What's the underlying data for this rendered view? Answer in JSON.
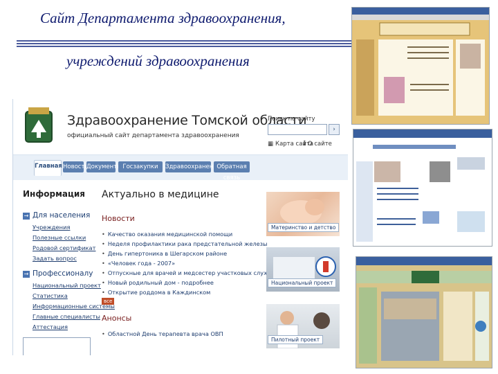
{
  "slide": {
    "title_line1": "Сайт Департамента здравоохранения,",
    "title_line2": "учреждений здравоохранения"
  },
  "site": {
    "name": "Здравоохранение Томской области",
    "subtitle": "официальный сайт департамента здравоохранения",
    "search_label": "Поиск по сайту",
    "util_sitemap": "Карта сайта",
    "util_about": "О сайте",
    "tabs": [
      "Главная",
      "Новости",
      "Документы",
      "Госзакупки",
      "Здравоохранение",
      "Обратная связь"
    ],
    "left_heading": "Информация",
    "sections": [
      {
        "label": "Для населения",
        "links": [
          "Учреждения",
          "Полезные ссылки",
          "Родовой сертификат",
          "Задать вопрос"
        ]
      },
      {
        "label": "Профессионалу",
        "links": [
          "Национальный проект",
          "Статистика",
          "Информационные системы",
          "Главные специалисты",
          "Аттестация"
        ]
      }
    ],
    "main_heading": "Актуально в медицине",
    "news_heading": "Новости",
    "news": [
      "Качество оказания медицинской помощи",
      "Неделя профилактики рака предстательной железы",
      "День гипертоника в Шегарском районе",
      "«Человек года - 2007»",
      "Отпускные для врачей и медсестер участковых служб",
      "Новый родильный дом - подробнее",
      "Открытие роддома в Каждинском"
    ],
    "more_label": "все",
    "announce_heading": "Анонсы",
    "announce": [
      "Областной День терапевта врача ОВП"
    ],
    "photos": [
      "Материнство и детство",
      "Национальный проект",
      "Пилотный проект"
    ]
  }
}
